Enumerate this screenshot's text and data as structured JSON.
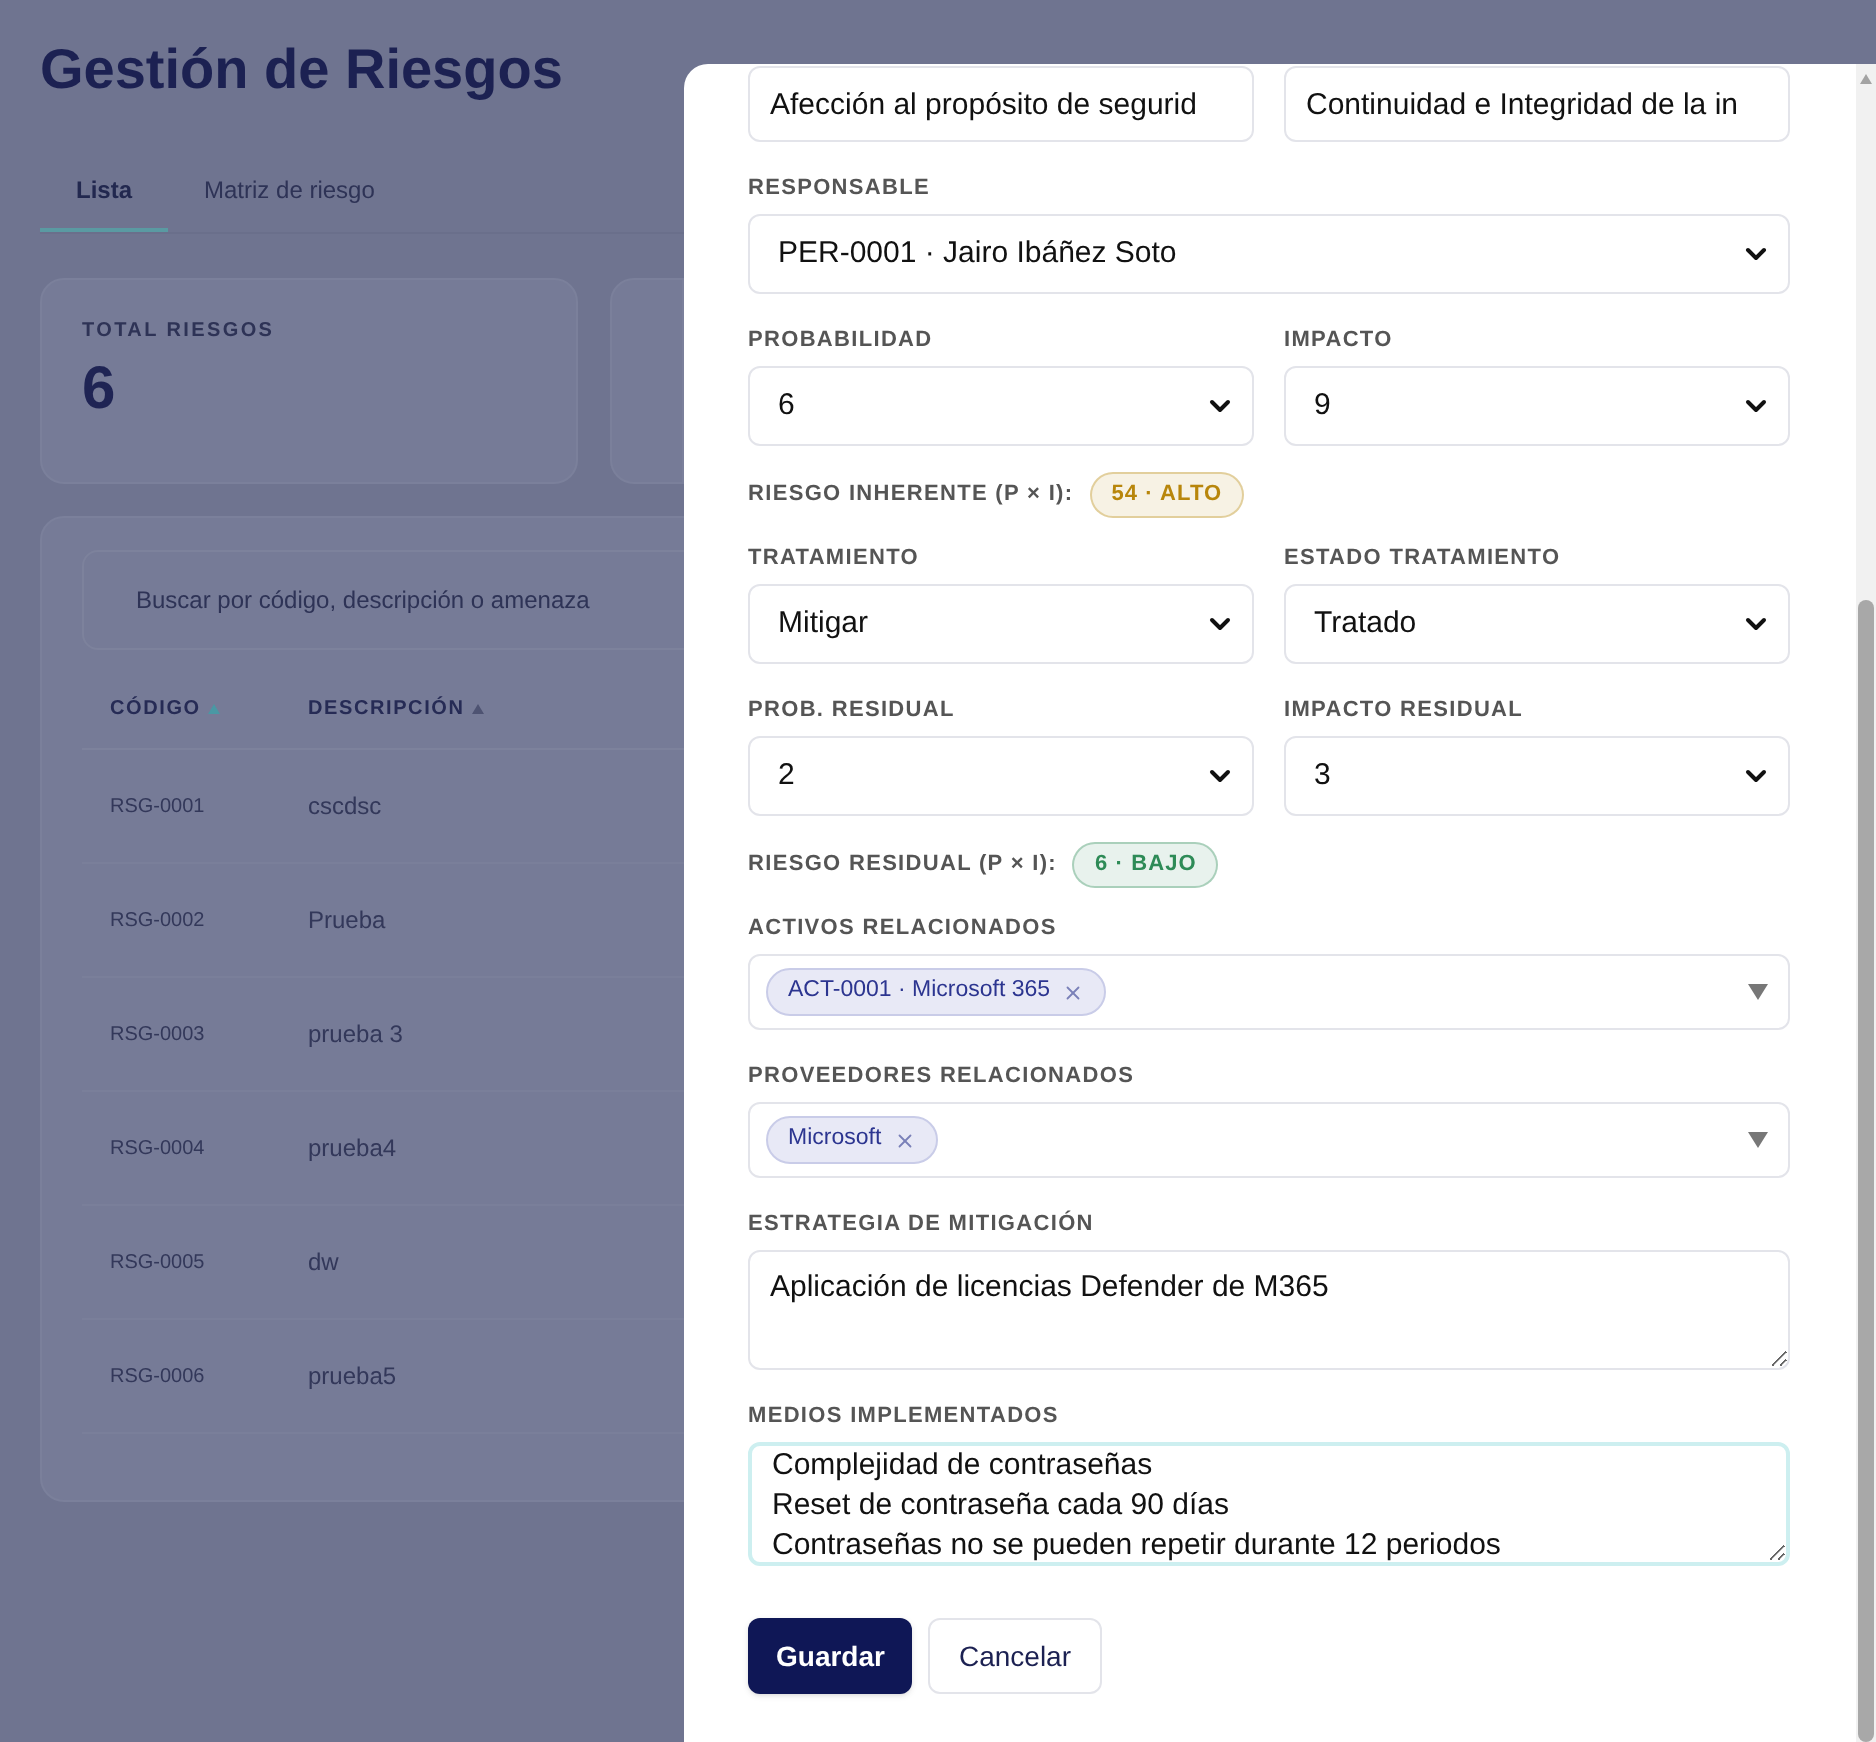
{
  "page": {
    "title": "Gestión de Riesgos",
    "tabs": [
      {
        "label": "Lista",
        "selected": true
      },
      {
        "label": "Matriz de riesgo",
        "selected": false
      }
    ],
    "stats": [
      {
        "label": "TOTAL RIESGOS",
        "value": "6"
      }
    ],
    "search": {
      "placeholder": "Buscar por código, descripción o amenaza"
    },
    "table": {
      "columns": [
        {
          "label": "CÓDIGO",
          "sorted": true
        },
        {
          "label": "DESCRIPCIÓN",
          "sorted": false
        }
      ],
      "rows": [
        [
          "RSG-0001",
          "cscdsc"
        ],
        [
          "RSG-0002",
          "Prueba"
        ],
        [
          "RSG-0003",
          "prueba 3"
        ],
        [
          "RSG-0004",
          "prueba4"
        ],
        [
          "RSG-0005",
          "dw"
        ],
        [
          "RSG-0006",
          "prueba5"
        ]
      ]
    }
  },
  "modal": {
    "fields": [
      {
        "kind": "input_pair",
        "values": [
          "Afección al propósito de segurid",
          "Continuidad e Integridad de la in"
        ]
      },
      {
        "kind": "select",
        "label": "RESPONSABLE",
        "value": "PER-0001 · Jairo Ibáñez Soto"
      },
      {
        "kind": "select_pair",
        "fields": [
          {
            "label": "PROBABILIDAD",
            "value": "6"
          },
          {
            "label": "IMPACTO",
            "value": "9"
          }
        ]
      },
      {
        "kind": "score",
        "label": "RIESGO INHERENTE (P × I):",
        "badge": "54 · ALTO",
        "color": "#b8860b"
      },
      {
        "kind": "select_pair",
        "fields": [
          {
            "label": "TRATAMIENTO",
            "value": "Mitigar"
          },
          {
            "label": "ESTADO TRATAMIENTO",
            "value": "Tratado"
          }
        ]
      },
      {
        "kind": "select_pair",
        "fields": [
          {
            "label": "PROB. RESIDUAL",
            "value": "2"
          },
          {
            "label": "IMPACTO RESIDUAL",
            "value": "3"
          }
        ]
      },
      {
        "kind": "score",
        "label": "RIESGO RESIDUAL (P × I):",
        "badge": "6 · BAJO",
        "color": "#2e8b57"
      },
      {
        "kind": "multiselect",
        "label": "ACTIVOS RELACIONADOS",
        "tags": [
          "ACT-0001 · Microsoft 365"
        ]
      },
      {
        "kind": "multiselect",
        "label": "PROVEEDORES RELACIONADOS",
        "tags": [
          "Microsoft"
        ]
      },
      {
        "kind": "textarea",
        "label": "ESTRATEGIA DE MITIGACIÓN",
        "lines": [
          "Aplicación de licencias Defender de M365"
        ],
        "focused": false
      },
      {
        "kind": "textarea",
        "label": "MEDIOS IMPLEMENTADOS",
        "lines": [
          "Complejidad de contraseñas",
          "Reset de contraseña cada 90 días",
          "Contraseñas no se pueden repetir durante 12 periodos"
        ],
        "focused": true
      }
    ],
    "buttons": [
      {
        "label": "Guardar",
        "kind": "primary"
      },
      {
        "label": "Cancelar",
        "kind": "secondary"
      }
    ]
  }
}
